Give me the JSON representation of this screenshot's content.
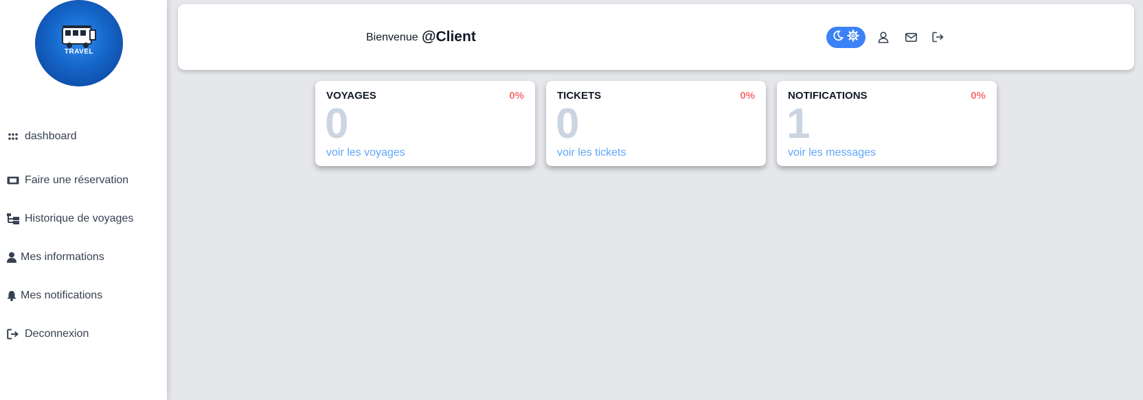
{
  "sidebar": {
    "logo_text": "TRAVEL",
    "items": [
      {
        "label": "dashboard",
        "icon": "grid-icon"
      },
      {
        "label": "Faire une réservation",
        "icon": "ticket-icon"
      },
      {
        "label": "Historique de voyages",
        "icon": "history-icon"
      },
      {
        "label": "Mes informations",
        "icon": "user-icon"
      },
      {
        "label": "Mes notifications",
        "icon": "bell-icon"
      },
      {
        "label": "Deconnexion",
        "icon": "logout-icon"
      }
    ]
  },
  "header": {
    "welcome": "Bienvenue",
    "username": "@Client",
    "icons": [
      "moon-icon",
      "gear-icon",
      "user-icon",
      "mail-icon",
      "logout-icon"
    ],
    "toggle_color": "#3b82f6"
  },
  "cards": [
    {
      "title": "VOYAGES",
      "percent": "0%",
      "value": "0",
      "link": "voir les voyages"
    },
    {
      "title": "TICKETS",
      "percent": "0%",
      "value": "0",
      "link": "voir les tickets"
    },
    {
      "title": "NOTIFICATIONS",
      "percent": "0%",
      "value": "1",
      "link": "voir les messages"
    }
  ],
  "colors": {
    "background": "#e5e7eb",
    "accent": "#3b82f6",
    "percent": "#f87171",
    "link": "#60a5fa",
    "value": "#cbd5e1"
  }
}
